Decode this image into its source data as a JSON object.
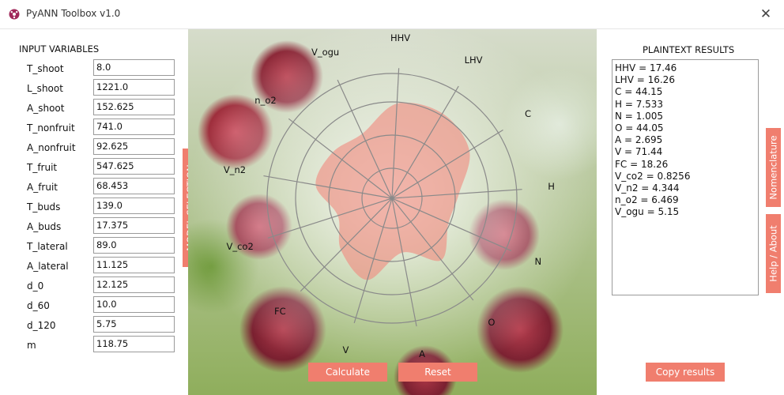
{
  "window": {
    "title": "PyANN Toolbox v1.0",
    "close_glyph": "✕"
  },
  "left": {
    "header": "INPUT VARIABLES",
    "variables": [
      {
        "label": "T_shoot",
        "value": "8.0"
      },
      {
        "label": "L_shoot",
        "value": "1221.0"
      },
      {
        "label": "A_shoot",
        "value": "152.625"
      },
      {
        "label": "T_nonfruit",
        "value": "741.0"
      },
      {
        "label": "A_nonfruit",
        "value": "92.625"
      },
      {
        "label": "T_fruit",
        "value": "547.625"
      },
      {
        "label": "A_fruit",
        "value": "68.453"
      },
      {
        "label": "T_buds",
        "value": "139.0"
      },
      {
        "label": "A_buds",
        "value": "17.375"
      },
      {
        "label": "T_lateral",
        "value": "89.0"
      },
      {
        "label": "A_lateral",
        "value": "11.125"
      },
      {
        "label": "d_0",
        "value": "12.125"
      },
      {
        "label": "d_60",
        "value": "10.0"
      },
      {
        "label": "d_120",
        "value": "5.75"
      },
      {
        "label": "m",
        "value": "118.75"
      }
    ],
    "model_selection_tab": "MODEL SELECTION"
  },
  "radar": {
    "axes": [
      "HHV",
      "LHV",
      "C",
      "H",
      "N",
      "O",
      "A",
      "V",
      "FC",
      "V_co2",
      "V_n2",
      "n_o2",
      "V_ogu"
    ],
    "fill_color": "#f08a80"
  },
  "buttons": {
    "calculate": "Calculate",
    "reset": "Reset",
    "copy": "Copy results"
  },
  "right": {
    "header": "PLAINTEXT RESULTS",
    "results": [
      "HHV = 17.46",
      "LHV = 16.26",
      "C = 44.15",
      "H = 7.533",
      "N = 1.005",
      "O = 44.05",
      "A = 2.695",
      "V = 71.44",
      "FC = 18.26",
      "V_co2 = 0.8256",
      "V_n2 = 4.344",
      "n_o2 = 6.469",
      "V_ogu = 5.15"
    ],
    "tabs": {
      "nomenclature": "Nomenclature",
      "help": "Help / About"
    }
  },
  "colors": {
    "accent": "#f07e6e"
  }
}
